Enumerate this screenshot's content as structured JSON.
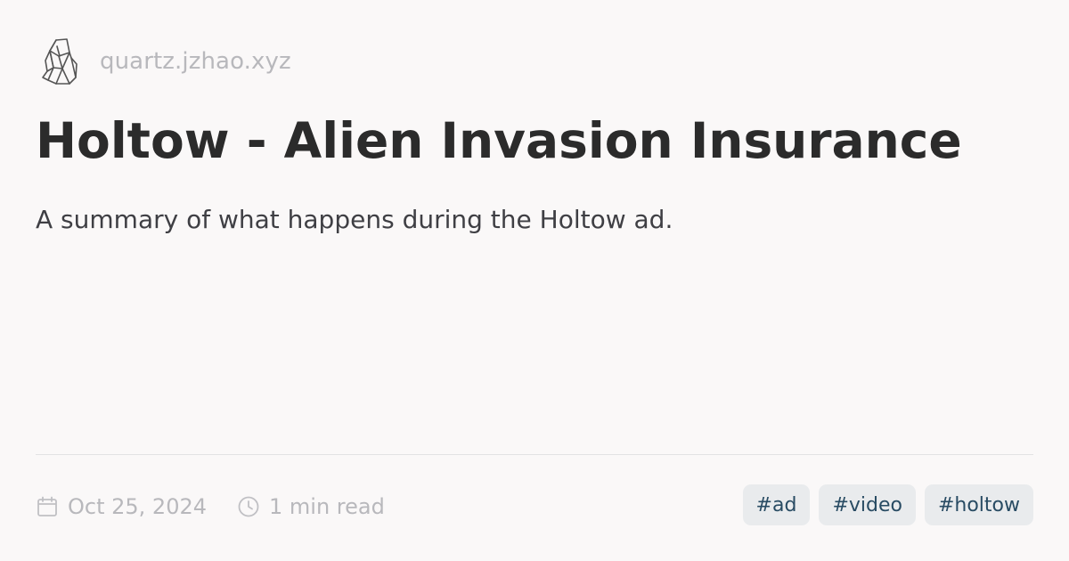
{
  "header": {
    "logo_icon": "crystal-logo-icon",
    "site_name": "quartz.jzhao.xyz"
  },
  "article": {
    "title": "Holtow - Alien Invasion Insurance",
    "description": "A summary of what happens during the Holtow ad."
  },
  "meta": {
    "date_icon": "calendar-icon",
    "date": "Oct 25, 2024",
    "reading_time_icon": "clock-icon",
    "reading_time": "1 min read"
  },
  "tags": [
    "#ad",
    "#video",
    "#holtow"
  ],
  "colors": {
    "background": "#faf8f8",
    "title": "#2b2b2b",
    "subtitle": "#3f3f44",
    "muted": "#b8b8bc",
    "tag_background": "#e9ebed",
    "tag_text": "#284b63"
  }
}
